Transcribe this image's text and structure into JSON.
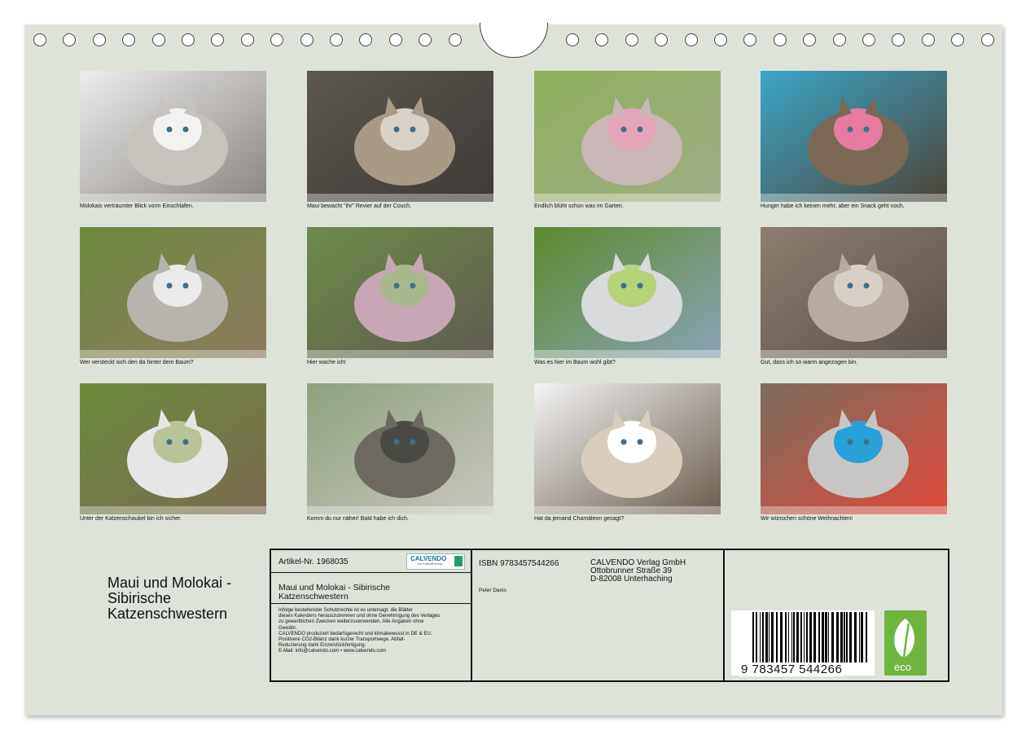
{
  "months": [
    {
      "caption": "Molokais verträumter Blick vorm Einschlafen.",
      "palette": [
        "#ececec",
        "#c6c2bc",
        "#8a8580",
        "#f2f2f0"
      ]
    },
    {
      "caption": "Maui bewacht \"ihr\" Revier auf der Couch.",
      "palette": [
        "#5d5750",
        "#a89a86",
        "#3e3a36",
        "#d8d2c8"
      ]
    },
    {
      "caption": "Endlich blüht schon was im Garten.",
      "palette": [
        "#8fb05c",
        "#c9b7b7",
        "#a0ad86",
        "#e2a6b8"
      ]
    },
    {
      "caption": "Hunger habe ich keinen mehr, aber ein Snack geht noch.",
      "palette": [
        "#3aa7c8",
        "#7a6855",
        "#4e4438",
        "#e77aa0"
      ]
    },
    {
      "caption": "Wer versteckt sich den da hinter dem Baum?",
      "palette": [
        "#6d8a3c",
        "#b7b4ad",
        "#8c7a60",
        "#eaeaea"
      ]
    },
    {
      "caption": "Hier wache ich!",
      "palette": [
        "#6e8c48",
        "#c7a6b6",
        "#5f5a52",
        "#a9b88c"
      ]
    },
    {
      "caption": "Was es hier im Baum wohl gibt?",
      "palette": [
        "#5d8a2d",
        "#d9dadb",
        "#8aa3b8",
        "#b5d279"
      ]
    },
    {
      "caption": "Gut, dass ich so warm angezogen bin.",
      "palette": [
        "#8d7e70",
        "#b7aba0",
        "#5b514a",
        "#d8d0c6"
      ]
    },
    {
      "caption": "Unter der Katzenschaukel bin ich sicher.",
      "palette": [
        "#6c8c3a",
        "#e6e6e6",
        "#7a6a52",
        "#b9c39a"
      ]
    },
    {
      "caption": "Komm du nur näher! Bald habe ich dich.",
      "palette": [
        "#8ea280",
        "#6e6a62",
        "#c9c6bd",
        "#4a4a44"
      ]
    },
    {
      "caption": "Hat da jemand Chamäleon gesagt?",
      "palette": [
        "#f3f3f3",
        "#d9cdbd",
        "#6b5d4e",
        "#ffffff"
      ]
    },
    {
      "caption": "Wir wünschen schöne Weihnachten!",
      "palette": [
        "#7b6d5f",
        "#c8c6c4",
        "#e04a3a",
        "#29a0d8"
      ]
    }
  ],
  "title_lines": [
    "Maui und Molokai -",
    "Sibirische",
    "Katzenschwestern"
  ],
  "info": {
    "artikel": "Artikel-Nr. 1968035",
    "logo_text": "CALVENDO",
    "logo_sub": "Der Kalenderverlag",
    "product_title_lines": [
      "Maui und Molokai - Sibirische",
      "Katzenschwestern"
    ],
    "legal_lines": [
      "Infolge bestehender Schutzrechte ist es untersagt, die Blätter",
      "dieses Kalenders herauszutrennen und ohne Genehmigung des Verlages",
      "zu gewerblichen Zwecken weiterzuverwenden. Alle Angaben ohne",
      "Gewähr.",
      "CALVENDO produziert bedarfsgerecht und klimabewusst in DE & EU.",
      "Positivere CO2-Bilanz dank kurzer Transportwege. Abfall-",
      "Reduzierung dank Einzelstückfertigung.",
      "E-Mail: info@calvendo.com • www.calvendo.com"
    ],
    "isbn": "ISBN 9783457544266",
    "author": "Peter Danis",
    "publisher_lines": [
      "CALVENDO Verlag GmbH",
      "Ottobrunner Straße 39",
      "D-82008 Unterhaching"
    ],
    "barcode_number": "9 783457 544266",
    "eco_label": "eco"
  },
  "colors": {
    "sheet": "#dde3d9",
    "border": "#111111",
    "eco_green": "#6fb43f"
  }
}
